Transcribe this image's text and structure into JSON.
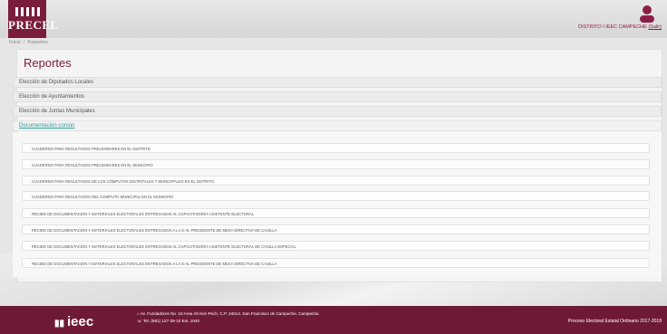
{
  "header": {
    "logo_text": "PRECEL",
    "user_label": "DISTRITO I IEEC CAMPECHE",
    "logout_label": "(Salir)"
  },
  "breadcrumb": {
    "home": "Inicio",
    "current": "Reportes"
  },
  "page": {
    "title": "Reportes"
  },
  "accordion": [
    {
      "label": "Elección de Diputados Locales"
    },
    {
      "label": "Elección de Ayuntamientos"
    },
    {
      "label": "Elección de Juntas Municipales"
    }
  ],
  "active_section": {
    "label": "Documentación común"
  },
  "documents": [
    "CUADERNO PARA RESULTADOS PRELIMINARES EN EL DISTRITO",
    "CUADERNO PARA RESULTADOS PRELIMINARES EN EL MUNICIPIO",
    "CUADERNO PARA RESULTADOS DE LOS CÓMPUTOS DISTRITALES Y MUNICIPALES EN EL DISTRITO",
    "CUADERNO PARA RESULTADOS DEL CÓMPUTO MUNICIPAL EN EL MUNICIPIO",
    "RECIBO DE DOCUMENTACIÓN Y MATERIALES ELECTORALES ENTREGADOS AL CAPACITADOR/A ASISTENTE ELECTORAL",
    "RECIBO DE DOCUMENTACIÓN Y MATERIALES ELECTORALES ENTREGADOS A LA O AL PRESIDENTE DE MESA DIRECTIVA DE CASILLA",
    "RECIBO DE DOCUMENTACIÓN Y MATERIALES ELECTORALES ENTREGADOS AL CAPACITADOR/A ASISTENTE ELECTORAL DE CASILLA ESPECIAL",
    "RECIBO DE DOCUMENTACIÓN Y MATERIALES ELECTORALES ENTREGADOS A LA O AL PRESIDENTE DE MESA DIRECTIVA DE CASILLA"
  ],
  "footer": {
    "logo_text": "ieec",
    "address": "Av. Fundadores No. 18 Area Ah Kim Pech, C.P. 24014. San Francisco de Campeche, Campeche.",
    "phone": "Tel. (981) 127-39-10 Ext. 1040",
    "right_note": "Proceso Electoral Estatal Ordinario 2017-2018"
  },
  "colors": {
    "brand": "#7a1d3c",
    "link": "#2e9b9b",
    "footer": "#6f1a35"
  }
}
